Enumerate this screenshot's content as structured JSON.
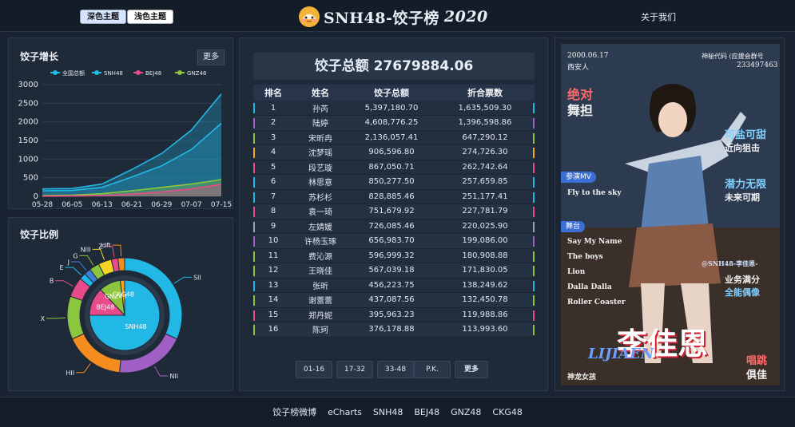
{
  "header": {
    "theme_dark": "深色主题",
    "theme_light": "浅色主题",
    "title": "SNH48-饺子榜",
    "year": "2020",
    "about": "关于我们"
  },
  "growth_panel": {
    "title": "饺子增长",
    "more": "更多"
  },
  "ratio_panel": {
    "title": "饺子比例"
  },
  "center": {
    "total_label": "饺子总额",
    "total_value": "27679884.06",
    "columns": [
      "排名",
      "姓名",
      "饺子总额",
      "折合票数"
    ],
    "rows": [
      {
        "rank": "1",
        "name": "孙芮",
        "total": "5,397,180.70",
        "votes": "1,635,509.30",
        "color": "#22b8e6"
      },
      {
        "rank": "2",
        "name": "陆婷",
        "total": "4,608,776.25",
        "votes": "1,396,598.86",
        "color": "#a05fc4"
      },
      {
        "rank": "3",
        "name": "宋昕冉",
        "total": "2,136,057.41",
        "votes": "647,290.12",
        "color": "#8cc63e"
      },
      {
        "rank": "4",
        "name": "沈梦瑶",
        "total": "906,596.80",
        "votes": "274,726.30",
        "color": "#f5a623"
      },
      {
        "rank": "5",
        "name": "段艺璇",
        "total": "867,050.71",
        "votes": "262,742.64",
        "color": "#e94a8a"
      },
      {
        "rank": "6",
        "name": "林思意",
        "total": "850,277.50",
        "votes": "257,659.85",
        "color": "#22b8e6"
      },
      {
        "rank": "7",
        "name": "苏杉杉",
        "total": "828,885.46",
        "votes": "251,177.41",
        "color": "#22b8e6"
      },
      {
        "rank": "8",
        "name": "袁一琦",
        "total": "751,679.92",
        "votes": "227,781.79",
        "color": "#e94a8a"
      },
      {
        "rank": "9",
        "name": "左婧媛",
        "total": "726,085.46",
        "votes": "220,025.90",
        "color": "#9aa4b0"
      },
      {
        "rank": "10",
        "name": "许杨玉琢",
        "total": "656,983.70",
        "votes": "199,086.00",
        "color": "#a05fc4"
      },
      {
        "rank": "11",
        "name": "费沁源",
        "total": "596,999.32",
        "votes": "180,908.88",
        "color": "#8cc63e"
      },
      {
        "rank": "12",
        "name": "王晓佳",
        "total": "567,039.18",
        "votes": "171,830.05",
        "color": "#8cc63e"
      },
      {
        "rank": "13",
        "name": "张昕",
        "total": "456,223.75",
        "votes": "138,249.62",
        "color": "#22b8e6"
      },
      {
        "rank": "14",
        "name": "谢蕾蕾",
        "total": "437,087.56",
        "votes": "132,450.78",
        "color": "#8cc63e"
      },
      {
        "rank": "15",
        "name": "郑丹妮",
        "total": "395,963.23",
        "votes": "119,988.86",
        "color": "#e94a8a"
      },
      {
        "rank": "16",
        "name": "陈珂",
        "total": "376,178.88",
        "votes": "113,993.60",
        "color": "#8cc63e"
      }
    ],
    "watermarks": [
      "SNH48",
      "饺子榜",
      "SNH48",
      "饺子榜"
    ],
    "pager": [
      "01-16",
      "17-32",
      "33-48",
      "P.K.",
      "更多"
    ]
  },
  "poster": {
    "date_left": "2000.06.17",
    "place": "西安人",
    "code_label": "神秘代码 (应援会群号",
    "code": "233497463",
    "slogan1a": "绝对",
    "slogan1b": "舞担",
    "tag_mv": "参演MV",
    "mv": "Fly to the sky",
    "tag_stage": "舞台",
    "stages": [
      "Say My Name",
      "The boys",
      "Lion",
      "Dalla Dalla",
      "Roller Coaster"
    ],
    "right1a": "可盐可甜",
    "right1b": "近向狙击",
    "right2a": "潜力无限",
    "right2b": "未来可期",
    "weibo": "@SNH48-李佳恩-",
    "right3a": "业务满分",
    "right3b": "全能偶像",
    "name": "李佳恩",
    "name_en": "LIJIAEN",
    "bottom_left": "神龙女孩",
    "bottom_right_a": "唱跳",
    "bottom_right_b": "俱佳"
  },
  "footer": {
    "links": [
      "饺子榜微博",
      "eCharts",
      "SNH48",
      "BEJ48",
      "GNZ48",
      "CKG48"
    ]
  },
  "colors": {
    "snh": "#22b8e6",
    "bej": "#e94a8a",
    "gnz": "#8cc63e",
    "all": "#22b8e6"
  },
  "chart_data": [
    {
      "type": "area",
      "x": [
        "05-28",
        "06-05",
        "06-13",
        "06-21",
        "06-29",
        "07-07",
        "07-15"
      ],
      "ylim": [
        0,
        3000
      ],
      "yticks": [
        0,
        500,
        1000,
        1500,
        2000,
        2500,
        3000
      ],
      "grid": true,
      "legend": "top",
      "series": [
        {
          "name": "全国总额",
          "values": [
            200,
            210,
            330,
            720,
            1150,
            1780,
            2750
          ],
          "color": "#22b8e6"
        },
        {
          "name": "SNH48",
          "values": [
            150,
            160,
            240,
            520,
            820,
            1260,
            1960
          ],
          "color": "#22b8e6"
        },
        {
          "name": "BEJ48",
          "values": [
            5,
            10,
            20,
            60,
            120,
            200,
            320
          ],
          "color": "#e94a8a"
        },
        {
          "name": "GNZ48",
          "values": [
            20,
            30,
            70,
            150,
            240,
            330,
            450
          ],
          "color": "#8cc63e"
        }
      ]
    },
    {
      "type": "pie",
      "inner": [
        {
          "label": "SNH48",
          "value": 75,
          "color": "#22b8e6"
        },
        {
          "label": "BEJ48",
          "value": 13,
          "color": "#e94a8a"
        },
        {
          "label": "GNZ48",
          "value": 10,
          "color": "#8cc63e"
        },
        {
          "label": "CKG48",
          "value": 2,
          "color": "#f5a623"
        }
      ],
      "outer": [
        {
          "label": "SII",
          "value": 34,
          "color": "#22b8e6"
        },
        {
          "label": "NII",
          "value": 21,
          "color": "#a05fc4"
        },
        {
          "label": "HII",
          "value": 18,
          "color": "#f58c1e"
        },
        {
          "label": "X",
          "value": 13,
          "color": "#8cc63e"
        },
        {
          "label": "B",
          "value": 6,
          "color": "#e94a8a"
        },
        {
          "label": "E",
          "value": 2,
          "color": "#22b8e6"
        },
        {
          "label": "J",
          "value": 2,
          "color": "#3b7fd6"
        },
        {
          "label": "G",
          "value": 3,
          "color": "#8cc63e"
        },
        {
          "label": "NIII",
          "value": 4,
          "color": "#f5d423"
        },
        {
          "label": "Z",
          "value": 2,
          "color": "#e94a8a"
        },
        {
          "label": "idft",
          "value": 2,
          "color": "#f58c1e"
        }
      ]
    }
  ]
}
